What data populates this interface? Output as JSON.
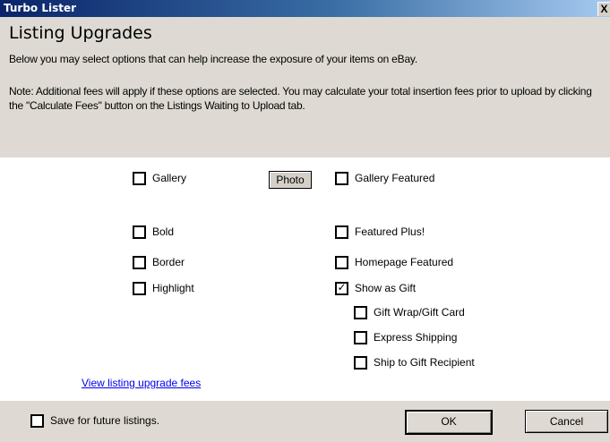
{
  "window": {
    "title": "Turbo Lister",
    "close_label": "X"
  },
  "header": {
    "heading": "Listing Upgrades",
    "intro": "Below you may select options that can help increase the exposure of your items on eBay.",
    "note": "Note: Additional fees will apply if these options are selected.  You may calculate your total insertion fees prior to upload by clicking the \"Calculate Fees\" button on the Listings Waiting to Upload tab."
  },
  "options": {
    "gallery": {
      "label": "Gallery",
      "checked": false
    },
    "photo_button": "Photo",
    "gallery_featured": {
      "label": "Gallery Featured",
      "checked": false
    },
    "bold": {
      "label": "Bold",
      "checked": false
    },
    "featured_plus": {
      "label": "Featured Plus!",
      "checked": false
    },
    "border": {
      "label": "Border",
      "checked": false
    },
    "homepage_featured": {
      "label": "Homepage Featured",
      "checked": false
    },
    "highlight": {
      "label": "Highlight",
      "checked": false
    },
    "show_as_gift": {
      "label": "Show as Gift",
      "checked": true,
      "mark": "✓"
    },
    "gift_wrap": {
      "label": "Gift Wrap/Gift Card",
      "checked": false
    },
    "express_shipping": {
      "label": "Express Shipping",
      "checked": false
    },
    "ship_to_recipient": {
      "label": "Ship to Gift Recipient",
      "checked": false
    }
  },
  "link": {
    "view_fees": "View listing upgrade fees"
  },
  "footer": {
    "save_future": {
      "label": "Save for future listings.",
      "checked": false
    },
    "ok_label": "OK",
    "cancel_label": "Cancel"
  },
  "colors": {
    "title_start": "#0a246a",
    "title_end": "#a6caf0",
    "panel": "#dedad3",
    "link": "#0000ee"
  }
}
